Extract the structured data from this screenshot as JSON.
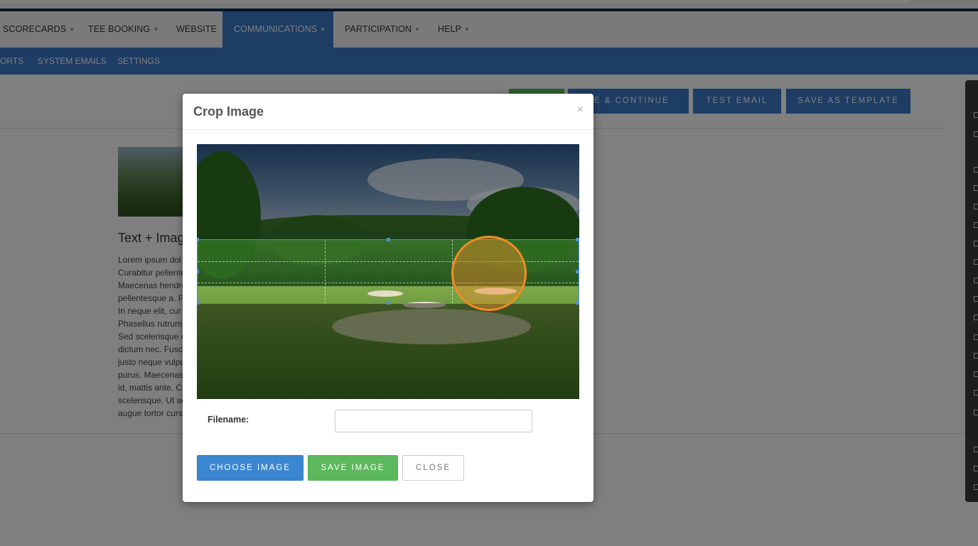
{
  "nav": {
    "main": [
      {
        "label": "SCORECARDS",
        "caret": true
      },
      {
        "label": "TEE BOOKING",
        "caret": true
      },
      {
        "label": "WEBSITE",
        "caret": false
      },
      {
        "label": "COMMUNICATIONS",
        "caret": true
      },
      {
        "label": "PARTICIPATION",
        "caret": true
      },
      {
        "label": "HELP",
        "caret": true
      }
    ],
    "sub": [
      "ORTS",
      "SYSTEM EMAILS",
      "SETTINGS"
    ]
  },
  "toolbar": {
    "save_continue": "VE & CONTINUE",
    "test_email": "TEST EMAIL",
    "save_template": "SAVE AS TEMPLATE"
  },
  "content": {
    "heading": "Text + Imag",
    "lorem_lines": [
      "Lorem ipsum dol",
      "Curabitur pellente",
      "Maecenas hendre",
      "pellentesque a. P",
      "In neque elit, cur",
      "Phasellus rutrum",
      "Sed scelerisque e",
      "dictum nec. Fusc",
      "justo neque vulpu",
      "purus. Maecenas",
      "id, mattis ante. C",
      "scelerisque. Ut ac",
      "augue tortor curs"
    ]
  },
  "modal": {
    "title": "Crop Image",
    "close_glyph": "×",
    "filename_label": "Filename:",
    "filename_value": "",
    "filename_placeholder": "",
    "buttons": {
      "choose": "CHOOSE IMAGE",
      "save": "SAVE IMAGE",
      "close": "CLOSE"
    }
  },
  "colors": {
    "primary": "#3a7bc8",
    "success": "#5cb85c",
    "highlight": "#f28c28"
  }
}
